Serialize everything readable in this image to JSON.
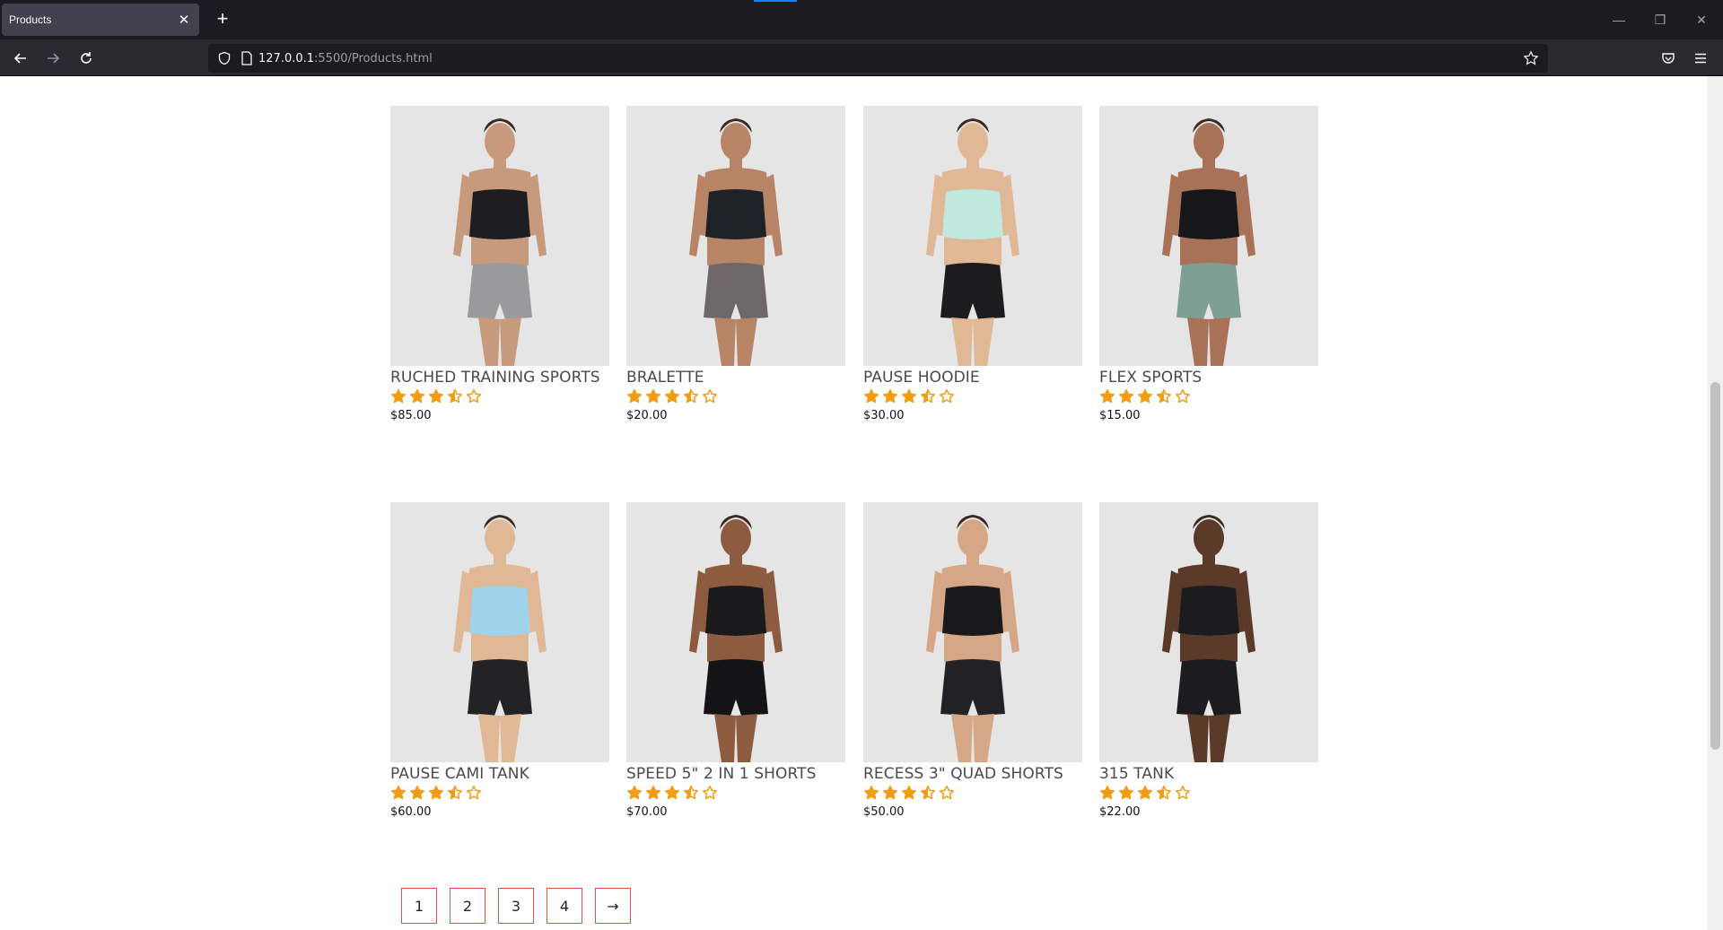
{
  "browser": {
    "tab_title": "Products",
    "url_host": "127.0.0.1",
    "url_rest": ":5500/Products.html"
  },
  "colors": {
    "star": "#f39c12",
    "pager_border": "#e0533f"
  },
  "products": [
    {
      "name": "RUCHED TRAINING SPORTS",
      "price": "$85.00",
      "rating": 3.5,
      "top": "#1e1e22",
      "bottom": "#9a9a9d",
      "skin": "#c79a7e"
    },
    {
      "name": "BRALETTE",
      "price": "$20.00",
      "rating": 3.5,
      "top": "#1f2128",
      "bottom": "#6e6668",
      "skin": "#b78466"
    },
    {
      "name": "PAUSE HOODIE",
      "price": "$30.00",
      "rating": 3.5,
      "top": "#bfe9de",
      "bottom": "#1c1c1e",
      "skin": "#e1b896"
    },
    {
      "name": "FLEX SPORTS",
      "price": "$15.00",
      "rating": 3.5,
      "top": "#17171a",
      "bottom": "#7f9f94",
      "skin": "#a87258"
    },
    {
      "name": "PAUSE CAMI TANK",
      "price": "$60.00",
      "rating": 3.5,
      "top": "#9fd3ec",
      "bottom": "#232326",
      "skin": "#e1b896"
    },
    {
      "name": "SPEED 5\" 2 IN 1 SHORTS",
      "price": "$70.00",
      "rating": 3.5,
      "top": "#1a1a1c",
      "bottom": "#141416",
      "skin": "#8c5b40"
    },
    {
      "name": "RECESS 3\" QUAD SHORTS",
      "price": "$50.00",
      "rating": 3.5,
      "top": "#1a1a1c",
      "bottom": "#222226",
      "skin": "#d6a787"
    },
    {
      "name": "315 TANK",
      "price": "$22.00",
      "rating": 3.5,
      "top": "#1c1c1f",
      "bottom": "#1c1c1f",
      "skin": "#5b3a2a"
    }
  ],
  "pagination": [
    "1",
    "2",
    "3",
    "4",
    "→"
  ]
}
